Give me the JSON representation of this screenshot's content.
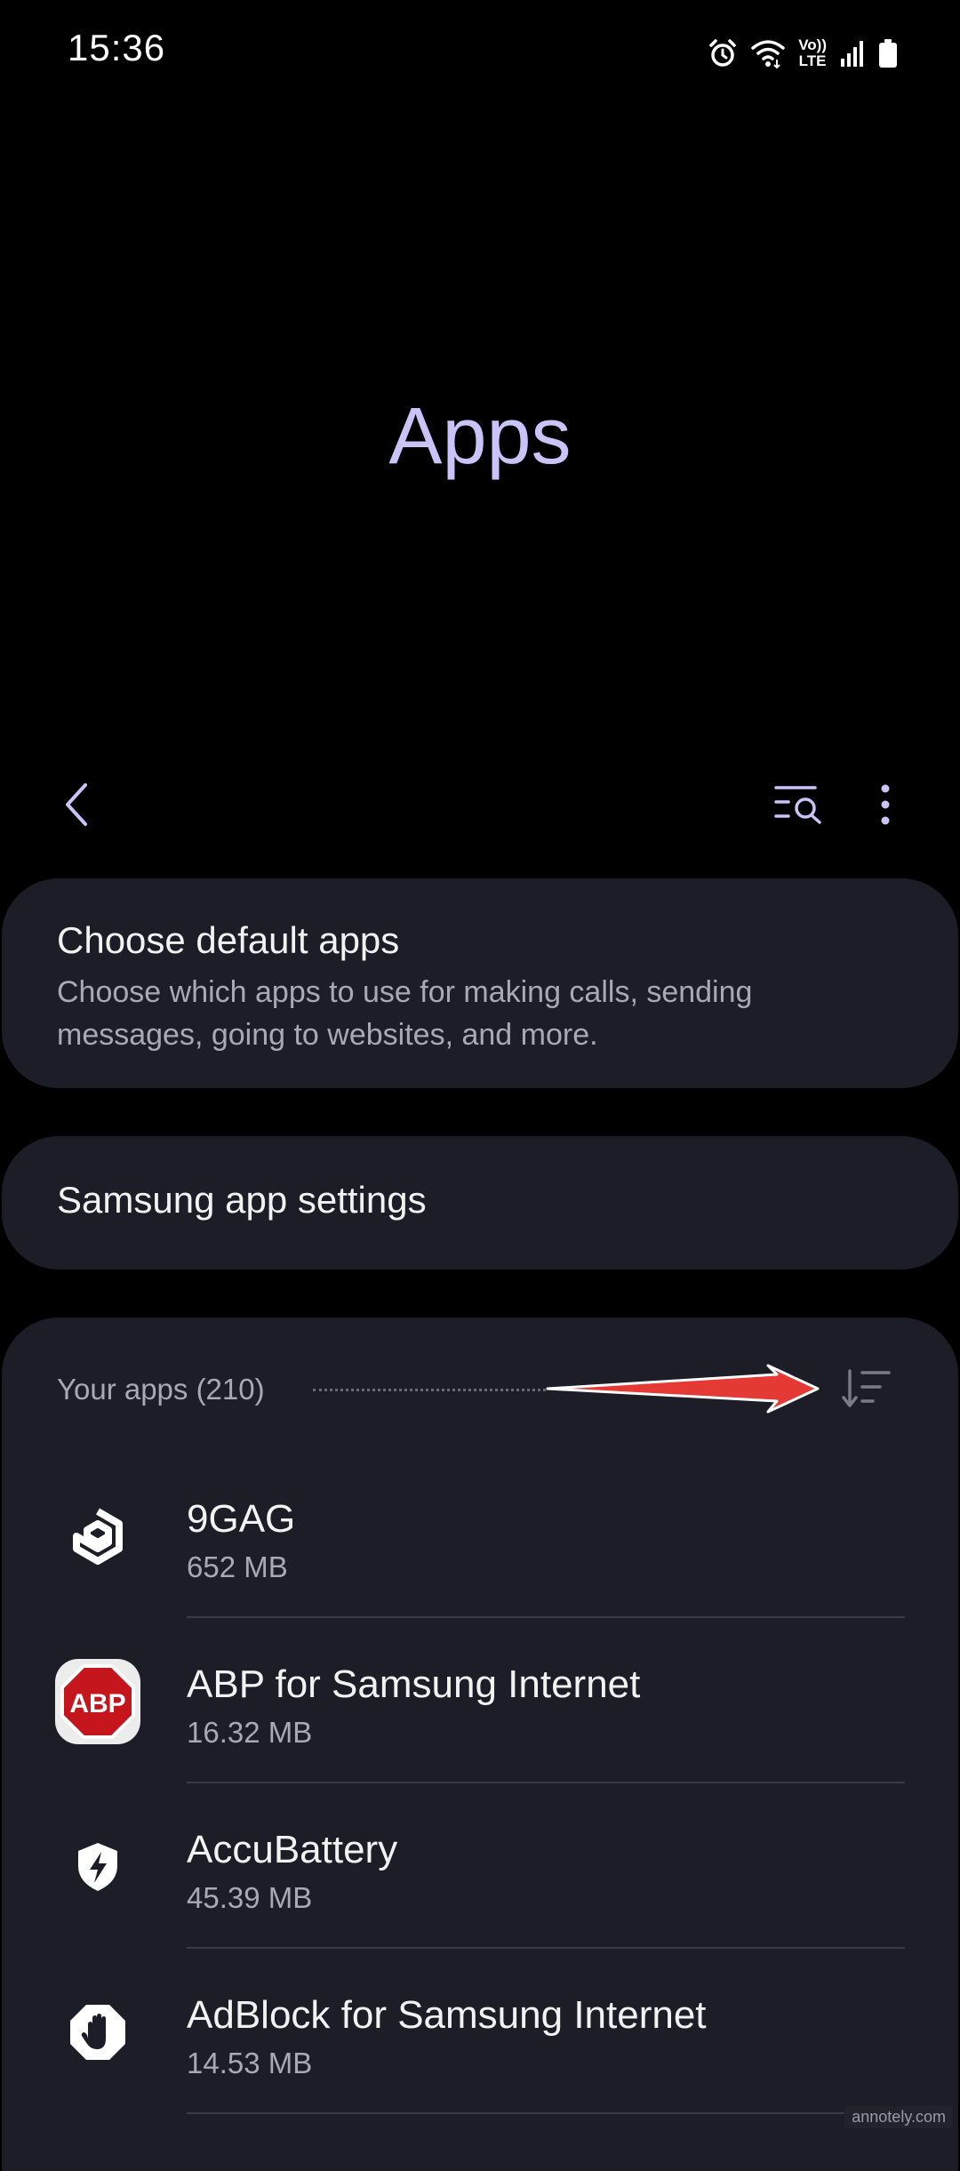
{
  "status_bar": {
    "time": "15:36",
    "icons": [
      "alarm-icon",
      "wifi-icon",
      "volte-lte-icon",
      "signal-icon",
      "battery-icon"
    ],
    "volte_label": "Vo))",
    "lte_label": "LTE"
  },
  "page": {
    "title": "Apps"
  },
  "toolbar": {
    "back_icon": "chevron-left-icon",
    "search_icon": "list-search-icon",
    "more_icon": "more-vertical-icon"
  },
  "cards": {
    "default_apps": {
      "title": "Choose default apps",
      "description": "Choose which apps to use for making calls, sending messages, going to websites, and more."
    },
    "samsung_settings": {
      "title": "Samsung app settings"
    }
  },
  "apps_section": {
    "header": "Your apps (210)",
    "sort_icon": "sort-icon",
    "items": [
      {
        "name": "9GAG",
        "size": "652 MB",
        "icon": "9gag-icon"
      },
      {
        "name": "ABP for Samsung Internet",
        "size": "16.32 MB",
        "icon": "abp-icon",
        "icon_label": "ABP"
      },
      {
        "name": "AccuBattery",
        "size": "45.39 MB",
        "icon": "accubattery-icon"
      },
      {
        "name": "AdBlock for Samsung Internet",
        "size": "14.53 MB",
        "icon": "adblock-icon"
      }
    ]
  },
  "watermark": "annotely.com",
  "colors": {
    "background": "#000000",
    "card": "#1d1d28",
    "title_accent": "#c9c3f7",
    "secondary_text": "#a9a9b1",
    "arrow": "#e53935"
  }
}
